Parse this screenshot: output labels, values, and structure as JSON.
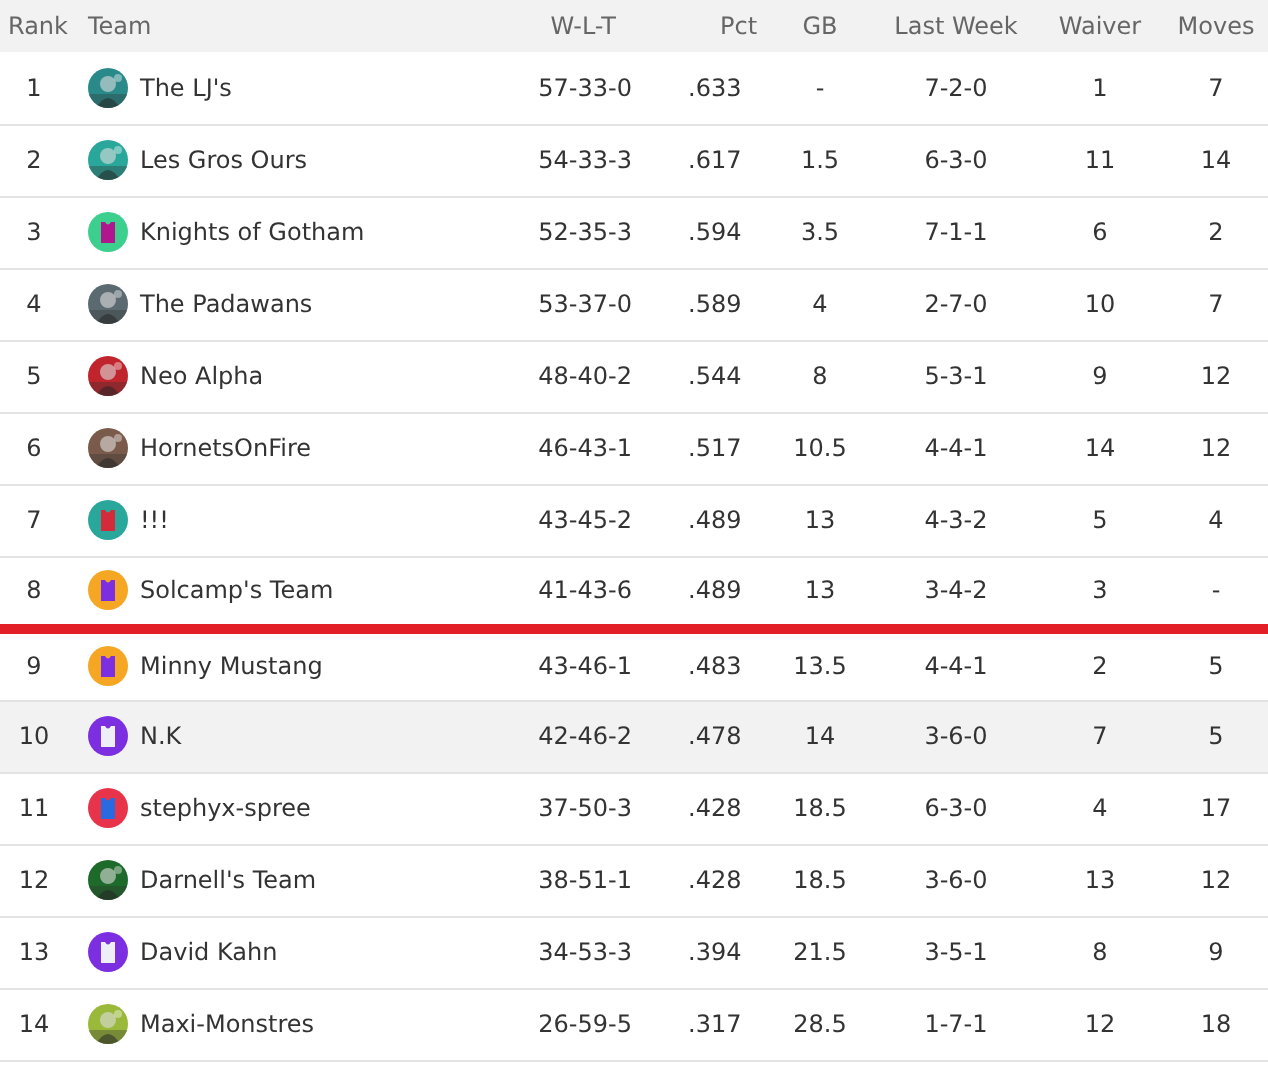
{
  "table": {
    "columns": [
      "Rank",
      "Team",
      "W-L-T",
      "Pct",
      "GB",
      "Last Week",
      "Waiver",
      "Moves"
    ],
    "rows": [
      {
        "rank": "1",
        "team": "The LJ's",
        "wlt": "57-33-0",
        "pct": ".633",
        "gb": "-",
        "last_week": "7-2-0",
        "waiver": "1",
        "moves": "7",
        "highlighted": false,
        "cutoff_below": false
      },
      {
        "rank": "2",
        "team": "Les Gros Ours",
        "wlt": "54-33-3",
        "pct": ".617",
        "gb": "1.5",
        "last_week": "6-3-0",
        "waiver": "11",
        "moves": "14",
        "highlighted": false,
        "cutoff_below": false
      },
      {
        "rank": "3",
        "team": "Knights of Gotham",
        "logo": {
          "kind": "jersey",
          "color": "#3ccf8e",
          "jersey": {
            "color": "#b0178f"
          }
        },
        "wlt": "52-35-3",
        "pct": ".594",
        "gb": "3.5",
        "last_week": "7-1-1",
        "waiver": "6",
        "moves": "2",
        "highlighted": false,
        "cutoff_below": false
      },
      {
        "rank": "4",
        "team": "The Padawans",
        "wlt": "53-37-0",
        "pct": ".589",
        "gb": "4",
        "last_week": "2-7-0",
        "waiver": "10",
        "moves": "7",
        "highlighted": false,
        "cutoff_below": false
      },
      {
        "rank": "5",
        "team": "Neo Alpha",
        "wlt": "48-40-2",
        "pct": ".544",
        "gb": "8",
        "last_week": "5-3-1",
        "waiver": "9",
        "moves": "12",
        "highlighted": false,
        "cutoff_below": false
      },
      {
        "rank": "6",
        "team": "HornetsOnFire",
        "wlt": "46-43-1",
        "pct": ".517",
        "gb": "10.5",
        "last_week": "4-4-1",
        "waiver": "14",
        "moves": "12",
        "highlighted": false,
        "cutoff_below": false
      },
      {
        "rank": "7",
        "team": "!!!",
        "logo": {
          "kind": "jersey",
          "color": "#2aa79b",
          "jersey": {
            "color": "#d42a3a"
          }
        },
        "wlt": "43-45-2",
        "pct": ".489",
        "gb": "13",
        "last_week": "4-3-2",
        "waiver": "5",
        "moves": "4",
        "highlighted": false,
        "cutoff_below": false
      },
      {
        "rank": "8",
        "team": "Solcamp's Team",
        "logo": {
          "kind": "jersey",
          "color": "#f5a623",
          "jersey": {
            "color": "#7b2fe0"
          }
        },
        "wlt": "41-43-6",
        "pct": ".489",
        "gb": "13",
        "last_week": "3-4-2",
        "waiver": "3",
        "moves": "-",
        "highlighted": false,
        "cutoff_below": true
      },
      {
        "rank": "9",
        "team": "Minny Mustang",
        "logo": {
          "kind": "jersey",
          "color": "#f5a623",
          "jersey": {
            "color": "#7b2fe0"
          }
        },
        "wlt": "43-46-1",
        "pct": ".483",
        "gb": "13.5",
        "last_week": "4-4-1",
        "waiver": "2",
        "moves": "5",
        "highlighted": false,
        "cutoff_below": false
      },
      {
        "rank": "10",
        "team": "N.K",
        "logo": {
          "kind": "jersey",
          "color": "#7b2fe0",
          "jersey": {
            "color": "#eeeef8"
          }
        },
        "wlt": "42-46-2",
        "pct": ".478",
        "gb": "14",
        "last_week": "3-6-0",
        "waiver": "7",
        "moves": "5",
        "highlighted": true,
        "cutoff_below": false
      },
      {
        "rank": "11",
        "team": "stephyx-spree",
        "logo": {
          "kind": "jersey",
          "color": "#e8344a",
          "jersey": {
            "color": "#2a6ae0"
          }
        },
        "wlt": "37-50-3",
        "pct": ".428",
        "gb": "18.5",
        "last_week": "6-3-0",
        "waiver": "4",
        "moves": "17",
        "highlighted": false,
        "cutoff_below": false
      },
      {
        "rank": "12",
        "team": "Darnell's Team",
        "wlt": "38-51-1",
        "pct": ".428",
        "gb": "18.5",
        "last_week": "3-6-0",
        "waiver": "13",
        "moves": "12",
        "highlighted": false,
        "cutoff_below": false
      },
      {
        "rank": "13",
        "team": "David Kahn",
        "logo": {
          "kind": "jersey",
          "color": "#7b2fe0",
          "jersey": {
            "color": "#eeeef8"
          }
        },
        "wlt": "34-53-3",
        "pct": ".394",
        "gb": "21.5",
        "last_week": "3-5-1",
        "waiver": "8",
        "moves": "9",
        "highlighted": false,
        "cutoff_below": false
      },
      {
        "rank": "14",
        "team": "Maxi-Monstres",
        "wlt": "26-59-5",
        "pct": ".317",
        "gb": "28.5",
        "last_week": "1-7-1",
        "waiver": "12",
        "moves": "18",
        "highlighted": false,
        "cutoff_below": false
      }
    ]
  }
}
